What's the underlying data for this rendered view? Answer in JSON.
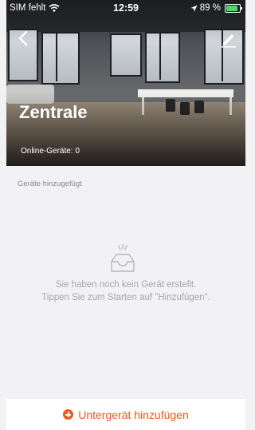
{
  "status_bar": {
    "carrier": "SIM fehlt",
    "time": "12:59",
    "battery": "89 %",
    "icons": [
      "wifi-icon",
      "location-icon",
      "battery-charging-icon"
    ]
  },
  "header": {
    "title": "Zentrale",
    "online_devices": "Online-Geräte: 0",
    "icons": [
      "back-chevron-icon",
      "edit-pencil-icon"
    ]
  },
  "content": {
    "section_label": "Geräte hinzugefügt",
    "empty_state": {
      "icon": "empty-tray-icon",
      "line1": "Sie haben noch kein Gerät erstellt.",
      "line2": "Tippen Sie zum Starten auf \"Hinzufügen\"."
    }
  },
  "bottom_action": {
    "label": "Untergerät hinzufügen",
    "icon": "plus-circle-icon"
  },
  "colors": {
    "accent": "#f2561d",
    "background": "#f2f2f4",
    "muted_text": "#a6a6aa",
    "battery_green": "#4cd964"
  }
}
